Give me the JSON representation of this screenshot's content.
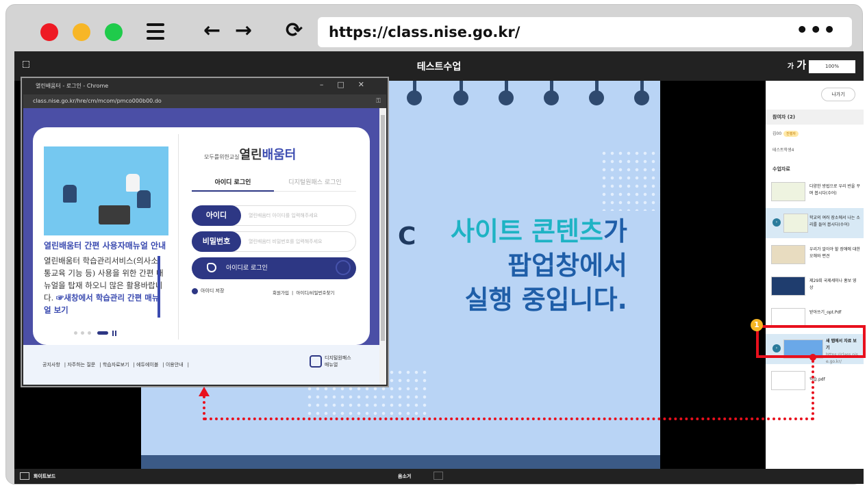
{
  "browser": {
    "back": "←",
    "forward": "→",
    "reload": "⟳",
    "url": "https://class.nise.go.kr/",
    "more": "•••"
  },
  "app": {
    "title": "테스트수업",
    "font_small": "가",
    "font_large": "가",
    "zoom": "100%",
    "exit_label": "나가기",
    "participants_header": "참여자 (2)",
    "participants": [
      {
        "name": "김00",
        "badge": "진행자"
      },
      {
        "name": "테스트학생4",
        "badge": ""
      }
    ],
    "materials_header": "수업자료",
    "materials": [
      {
        "label": "다양한 방법으로 우리 반을 꾸며 봅시다(수어)"
      },
      {
        "label": "학교의 여러 장소에서 나는 소리를 들어 봅시다(수어)"
      },
      {
        "label": "우리가 알아야 할 장애에 대한 오해와 편견"
      },
      {
        "label": "제29회 국제세미나 홍보 영상"
      },
      {
        "label": "받아쓰기_opt.Pdf"
      },
      {
        "label": "새 탭에서 자료 보기",
        "sub": "https://class.nise.go.kr/"
      },
      {
        "label": "학습.pdf"
      }
    ],
    "whiteboard": "화이트보드",
    "mic": "음소거",
    "annotation_number": "1"
  },
  "slide": {
    "partial_letter": "C",
    "line1_cyan": "사이트 콘텐츠",
    "line1_tail": "가",
    "line2": "팝업창에서",
    "line3": "실행 중입니다."
  },
  "popup": {
    "window_title": "열린배움터 - 로그인 - Chrome",
    "url": "class.nise.go.kr/hre/cm/mcom/pmco000b00.do",
    "manual_title": "열린배움터 간편 사용자매뉴얼 안내",
    "manual_body": "열린배움터 학습관리서비스(의사소통교육 기능 등) 사용을 위한 간편 매뉴얼을 탑재 하오니 많은 활용바랍니다.",
    "manual_link": "☞새창에서 학습관리 간편 매뉴얼 보기",
    "logo_small": "모두를위한교실",
    "logo_main": "열린",
    "logo_accent": "배움터",
    "tab_id": "아이디 로그인",
    "tab_digital": "디지털원패스 로그인",
    "id_label": "아이디",
    "id_placeholder": "열린배움터 아이디를 입력해주세요",
    "pw_label": "비밀번호",
    "pw_placeholder": "열린배움터 비밀번호를 입력해주세요",
    "login_button": "아이디로 로그인",
    "save_id": "아이디 저장",
    "join": "회원가입",
    "find": "아이디/비밀번호찾기",
    "footer_links": [
      "공지사항",
      "자주하는 질문",
      "학습자료보기",
      "에듀에이블",
      "이용안내"
    ],
    "footer_logo_1": "디지털원패스",
    "footer_logo_2": "매뉴얼"
  }
}
